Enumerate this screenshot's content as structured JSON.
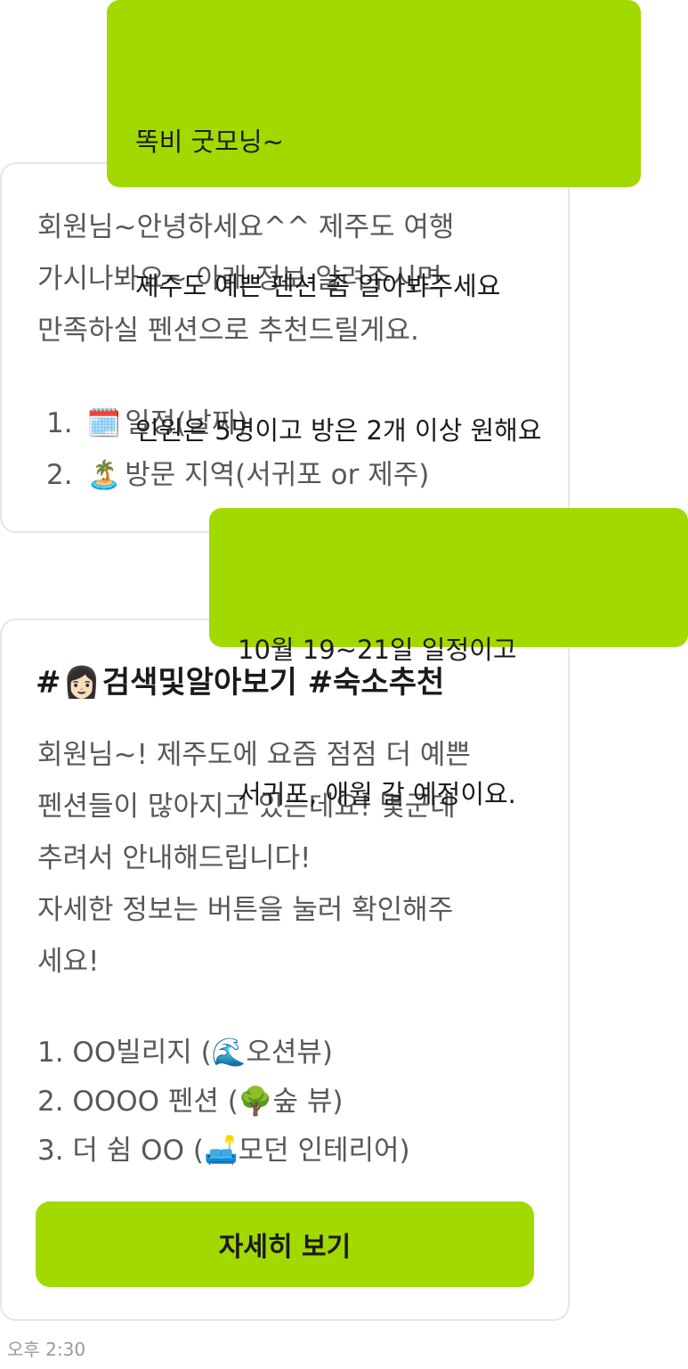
{
  "messages": {
    "user1": {
      "lines": [
        "똑비 굿모닝~",
        "제주도 예쁜 펜션 좀 알아봐주세요",
        "인원은 5명이고 방은 2개 이상 원해요"
      ]
    },
    "bot1": {
      "lines": [
        "회원님~안녕하세요^^ 제주도 여행",
        "가시나봐요~ 아래 정보 알려주시면",
        "만족하실 펜션으로 추천드릴게요."
      ],
      "list": [
        {
          "num": "1.",
          "icon": "calendar-icon",
          "glyph": "🗓️",
          "text": "일정(날짜)"
        },
        {
          "num": "2.",
          "icon": "island-icon",
          "glyph": "🏝️",
          "text": "방문 지역(서귀포 or 제주)"
        }
      ]
    },
    "user2": {
      "lines": [
        "10월 19~21일 일정이고",
        "서귀포, 애월 갈 예정이요."
      ]
    },
    "bot2": {
      "hashtag_prefix": "#",
      "hashtag_icon": "woman-icon",
      "hashtag_glyph": "👩🏻",
      "hashtag_text": "검색및알아보기 #숙소추천",
      "lines": [
        "회원님~! 제주도에 요즘 점점 더 예쁜",
        "펜션들이 많아지고 있는데요! 몇군데",
        "추려서 안내해드립니다!",
        "자세한 정보는 버튼을 눌러 확인해주",
        "세요!"
      ],
      "list": [
        {
          "prefix": "1. OO빌리지 (",
          "icon": "wave-icon",
          "glyph": "🌊",
          "suffix": "오션뷰)"
        },
        {
          "prefix": "2. OOOO 펜션 (",
          "icon": "tree-icon",
          "glyph": "🌳",
          "suffix": "숲 뷰)"
        },
        {
          "prefix": "3. 더 쉼 OO (",
          "icon": "couch-icon",
          "glyph": "🛋️",
          "suffix": "모던 인테리어)"
        }
      ],
      "button_label": "자세히 보기"
    }
  },
  "timestamp": "오후 2:30",
  "colors": {
    "accent_green": "#a2d900",
    "bubble_border": "#e6e6e6",
    "body_text": "#585858",
    "heading_text": "#1a1a1a"
  }
}
